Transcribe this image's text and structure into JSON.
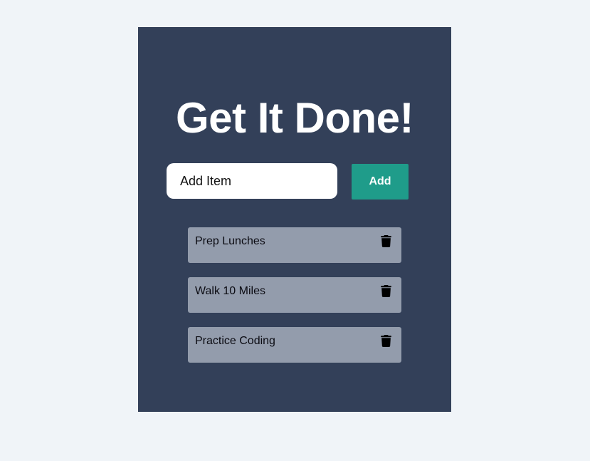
{
  "app": {
    "title": "Get It Done!"
  },
  "form": {
    "input_placeholder": "Add Item",
    "input_value": "",
    "add_label": "Add"
  },
  "todos": [
    {
      "label": "Prep Lunches",
      "icon": "trash-icon"
    },
    {
      "label": "Walk 10 Miles",
      "icon": "trash-icon"
    },
    {
      "label": "Practice Coding",
      "icon": "trash-icon"
    }
  ],
  "colors": {
    "page_bg": "#f0f4f8",
    "card_bg": "#334059",
    "accent": "#1f9c8a",
    "item_bg": "#939cac"
  }
}
